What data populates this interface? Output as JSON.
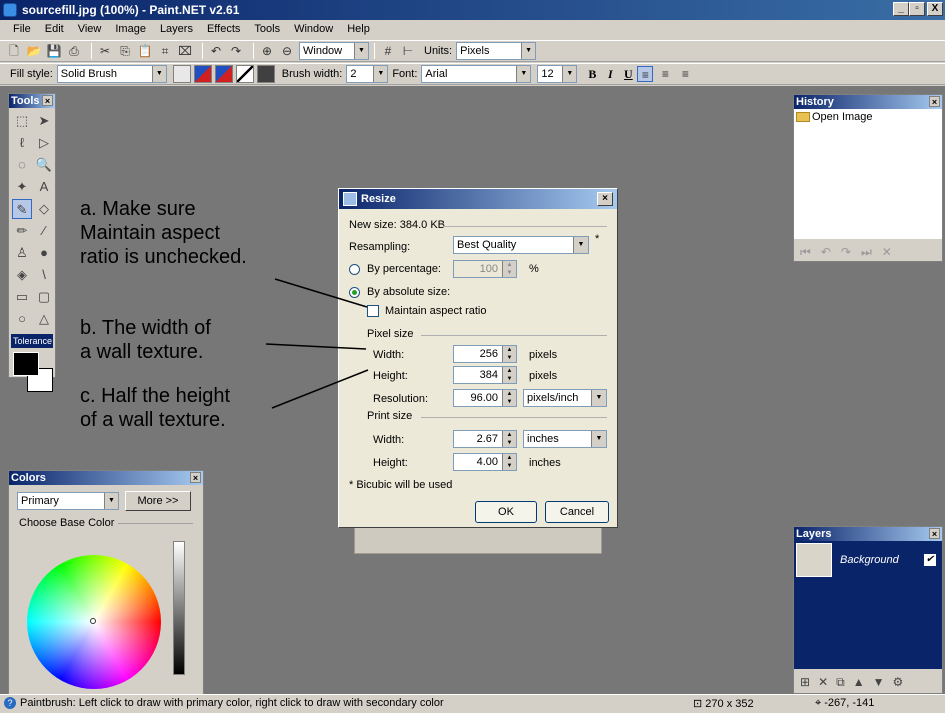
{
  "window": {
    "title": "sourcefill.jpg (100%) - Paint.NET v2.61",
    "min": "_",
    "max": " ",
    "close": "X"
  },
  "menu": [
    "File",
    "Edit",
    "View",
    "Image",
    "Layers",
    "Effects",
    "Tools",
    "Window",
    "Help"
  ],
  "toolbar1": {
    "window_combo": "Window",
    "units_label": "Units:",
    "units_value": "Pixels"
  },
  "toolbar2": {
    "fill_label": "Fill style:",
    "fill_value": "Solid Brush",
    "brush_label": "Brush width:",
    "brush_value": "2",
    "font_label": "Font:",
    "font_value": "Arial",
    "size_value": "12",
    "bold": "B",
    "italic": "I",
    "underline": "U"
  },
  "tools_panel": {
    "title": "Tools",
    "tolerance": "Tolerance"
  },
  "colors_panel": {
    "title": "Colors",
    "mode": "Primary",
    "more": "More >>",
    "choose_base": "Choose Base Color"
  },
  "history_panel": {
    "title": "History",
    "items": [
      "Open Image"
    ]
  },
  "layers_panel": {
    "title": "Layers",
    "layers": [
      {
        "name": "Background",
        "visible": true
      }
    ]
  },
  "dialog": {
    "title": "Resize",
    "new_size": "New size: 384.0 KB",
    "resampling_label": "Resampling:",
    "resampling_value": "Best Quality",
    "by_percentage": "By percentage:",
    "percentage_value": "100",
    "percent_sign": "%",
    "by_absolute": "By absolute size:",
    "maintain_aspect": "Maintain aspect ratio",
    "maintain_checked": false,
    "pixel_size": "Pixel size",
    "width_label": "Width:",
    "width_value": "256",
    "height_label": "Height:",
    "height_value": "384",
    "pixels_unit": "pixels",
    "resolution_label": "Resolution:",
    "resolution_value": "96.00",
    "resolution_unit": "pixels/inch",
    "print_size": "Print size",
    "print_width_value": "2.67",
    "print_height_value": "4.00",
    "inches_unit": "inches",
    "bicubic_note": "* Bicubic will be used",
    "ok": "OK",
    "cancel": "Cancel"
  },
  "annotations": {
    "a": [
      "a. Make sure",
      "Maintain aspect",
      "ratio is unchecked."
    ],
    "b": [
      "b. The width of",
      "a wall texture."
    ],
    "c": [
      "c. Half the height",
      "of a wall texture."
    ]
  },
  "status": {
    "message": "Paintbrush: Left click to draw with primary color, right click to draw with secondary color",
    "image_size": "270 x 352",
    "cursor": "-267, -141"
  }
}
